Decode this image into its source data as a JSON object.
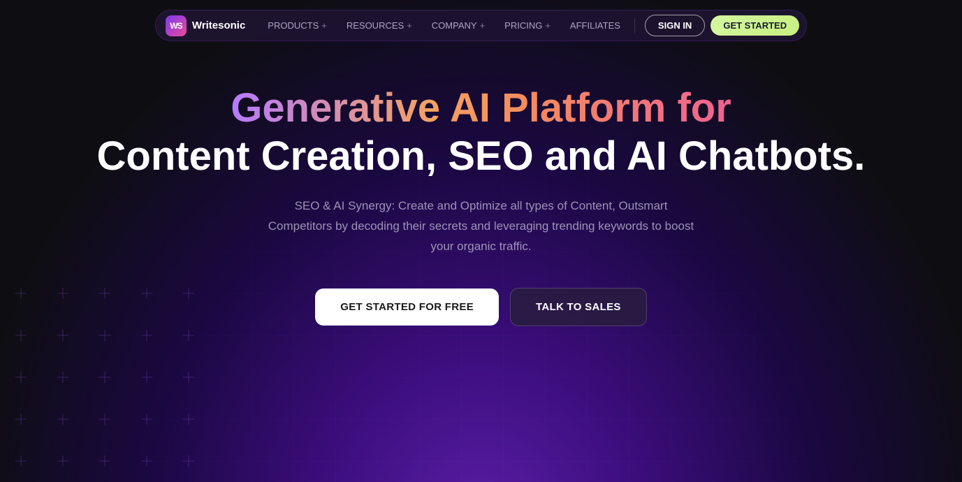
{
  "brand": {
    "logo_initials": "WS",
    "name": "Writesonic"
  },
  "navbar": {
    "items": [
      {
        "label": "PRODUCTS",
        "has_plus": true
      },
      {
        "label": "RESOURCES",
        "has_plus": true
      },
      {
        "label": "COMPANY",
        "has_plus": true
      },
      {
        "label": "PRICING",
        "has_plus": true
      },
      {
        "label": "AFFILIATES",
        "has_plus": false
      }
    ],
    "signin_label": "SIGN IN",
    "get_started_label": "GET STARTED"
  },
  "hero": {
    "title_line1": "Generative AI Platform for",
    "title_line2": "Content Creation, SEO and AI Chatbots.",
    "subtitle": "SEO & AI Synergy: Create and Optimize all types of Content, Outsmart Competitors by decoding their secrets and leveraging trending keywords to boost your organic traffic.",
    "btn_primary": "GET STARTED FOR FREE",
    "btn_secondary": "TALK TO SALES"
  }
}
